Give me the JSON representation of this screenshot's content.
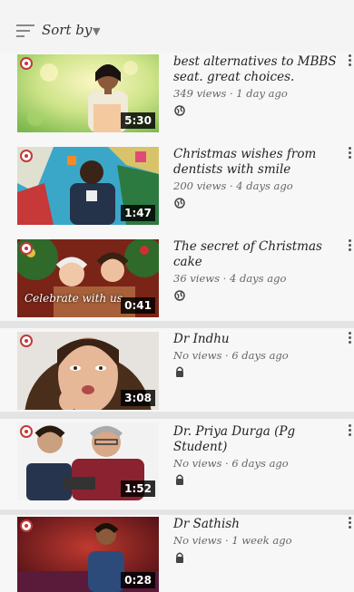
{
  "sort": {
    "label": "Sort by"
  },
  "videos": [
    {
      "title": "best alternatives to MBBS seat. great choices.",
      "meta": "349 views · 1 day ago",
      "duration": "5:30",
      "visibility": "public"
    },
    {
      "title": "Christmas wishes from dentists with smile",
      "meta": "200 views · 4 days ago",
      "duration": "1:47",
      "visibility": "public"
    },
    {
      "title": "The secret of Christmas cake",
      "meta": "36 views · 4 days ago",
      "duration": "0:41",
      "overlay_text": "Celebrate with us",
      "visibility": "public"
    },
    {
      "title": "Dr Indhu",
      "meta": "No views · 6 days ago",
      "duration": "3:08",
      "visibility": "private"
    },
    {
      "title": "Dr. Priya Durga (Pg Student)",
      "meta": "No views · 6 days ago",
      "duration": "1:52",
      "visibility": "private"
    },
    {
      "title": "Dr Sathish",
      "meta": "No views · 1 week ago",
      "duration": "0:28",
      "visibility": "private"
    }
  ],
  "colors": {
    "badge": "#c03a3a",
    "duration_bg": "#111111",
    "background": "#ececec"
  }
}
